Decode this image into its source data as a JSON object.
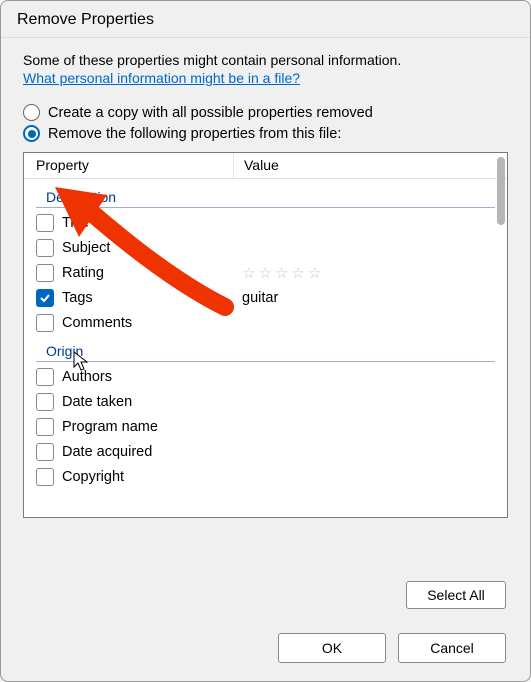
{
  "title": "Remove Properties",
  "intro": "Some of these properties might contain personal information.",
  "link": "What personal information might be in a file?",
  "radio1": "Create a copy with all possible properties removed",
  "radio2": "Remove the following properties from this file:",
  "headers": {
    "property": "Property",
    "value": "Value"
  },
  "groups": {
    "description": {
      "label": "Description",
      "items": [
        {
          "label": "Title",
          "checked": false,
          "value": ""
        },
        {
          "label": "Subject",
          "checked": false,
          "value": ""
        },
        {
          "label": "Rating",
          "checked": false,
          "value": "stars"
        },
        {
          "label": "Tags",
          "checked": true,
          "value": "guitar"
        },
        {
          "label": "Comments",
          "checked": false,
          "value": ""
        }
      ]
    },
    "origin": {
      "label": "Origin",
      "items": [
        {
          "label": "Authors",
          "checked": false,
          "value": ""
        },
        {
          "label": "Date taken",
          "checked": false,
          "value": ""
        },
        {
          "label": "Program name",
          "checked": false,
          "value": ""
        },
        {
          "label": "Date acquired",
          "checked": false,
          "value": ""
        },
        {
          "label": "Copyright",
          "checked": false,
          "value": ""
        }
      ]
    }
  },
  "buttons": {
    "selectAll": "Select All",
    "ok": "OK",
    "cancel": "Cancel"
  }
}
